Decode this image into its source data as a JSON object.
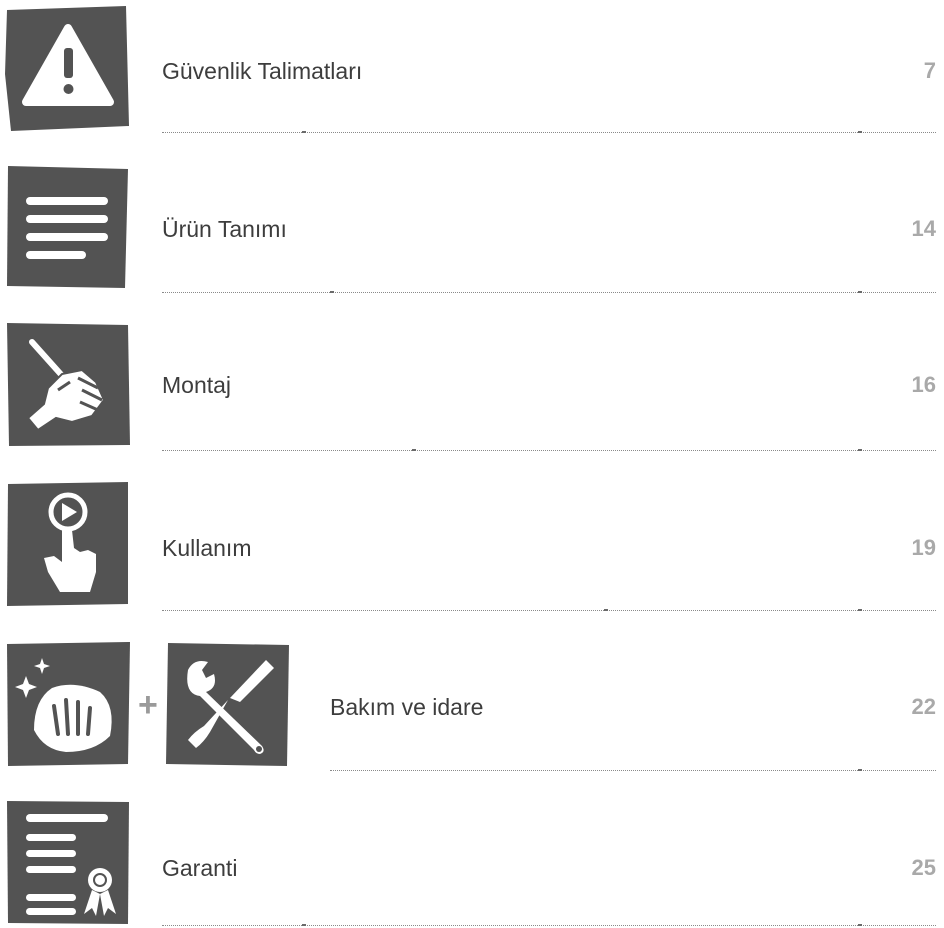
{
  "toc": [
    {
      "title": "Güvenlik Talimatları",
      "page": "7",
      "icon": "warning-icon"
    },
    {
      "title": "Ürün Tanımı",
      "page": "14",
      "icon": "document-lines-icon"
    },
    {
      "title": "Montaj",
      "page": "16",
      "icon": "hand-screwdriver-icon"
    },
    {
      "title": "Kullanım",
      "page": "19",
      "icon": "hand-play-button-icon"
    },
    {
      "title": "Bakım ve idare",
      "page": "22",
      "icon": "cleaning-hand-icon",
      "icon2": "wrench-screwdriver-icon",
      "joiner": "+"
    },
    {
      "title": "Garanti",
      "page": "25",
      "icon": "certificate-icon"
    }
  ],
  "colors": {
    "tile": "#535353",
    "text": "#3d3d3d",
    "page_number": "#a9a9a9"
  }
}
